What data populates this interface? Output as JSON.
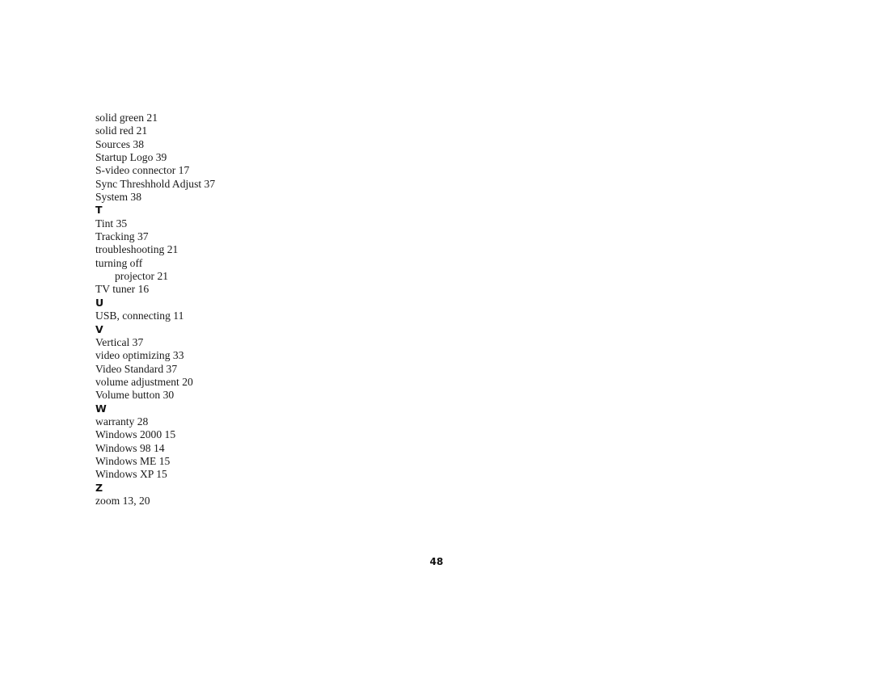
{
  "index": [
    {
      "type": "entry",
      "text": "solid green 21"
    },
    {
      "type": "entry",
      "text": "solid red 21"
    },
    {
      "type": "entry",
      "text": "Sources 38"
    },
    {
      "type": "entry",
      "text": "Startup Logo 39"
    },
    {
      "type": "entry",
      "text": "S-video connector 17"
    },
    {
      "type": "entry",
      "text": "Sync Threshhold Adjust 37"
    },
    {
      "type": "entry",
      "text": "System 38"
    },
    {
      "type": "letter",
      "text": "T"
    },
    {
      "type": "entry",
      "text": "Tint 35"
    },
    {
      "type": "entry",
      "text": "Tracking 37"
    },
    {
      "type": "entry",
      "text": "troubleshooting 21"
    },
    {
      "type": "entry",
      "text": "turning off"
    },
    {
      "type": "sub",
      "text": "projector 21"
    },
    {
      "type": "entry",
      "text": "TV tuner 16"
    },
    {
      "type": "letter",
      "text": "U"
    },
    {
      "type": "entry",
      "text": "USB, connecting 11"
    },
    {
      "type": "letter",
      "text": "V"
    },
    {
      "type": "entry",
      "text": "Vertical 37"
    },
    {
      "type": "entry",
      "text": "video optimizing 33"
    },
    {
      "type": "entry",
      "text": "Video Standard 37"
    },
    {
      "type": "entry",
      "text": "volume adjustment 20"
    },
    {
      "type": "entry",
      "text": "Volume button 30"
    },
    {
      "type": "letter",
      "text": "W"
    },
    {
      "type": "entry",
      "text": "warranty 28"
    },
    {
      "type": "entry",
      "text": "Windows 2000 15"
    },
    {
      "type": "entry",
      "text": "Windows 98 14"
    },
    {
      "type": "entry",
      "text": "Windows ME 15"
    },
    {
      "type": "entry",
      "text": "Windows XP 15"
    },
    {
      "type": "letter",
      "text": "Z"
    },
    {
      "type": "entry",
      "text": "zoom 13, 20"
    }
  ],
  "page_number": "48"
}
